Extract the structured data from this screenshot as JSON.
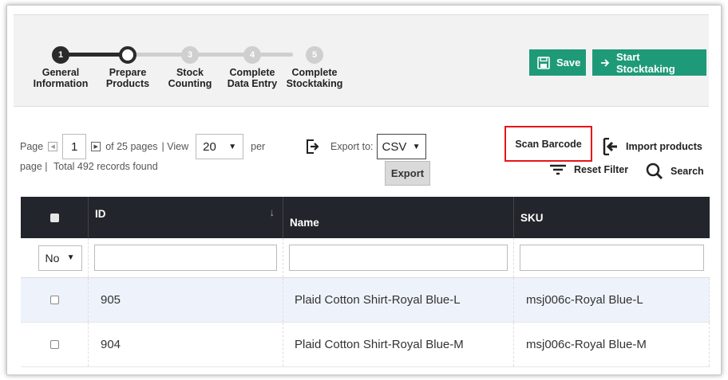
{
  "steps": [
    {
      "num": "1",
      "label": "General\nInformation",
      "state": "done"
    },
    {
      "num": "2",
      "label": "Prepare\nProducts",
      "state": "current"
    },
    {
      "num": "3",
      "label": "Stock\nCounting",
      "state": "todo"
    },
    {
      "num": "4",
      "label": "Complete\nData Entry",
      "state": "todo"
    },
    {
      "num": "5",
      "label": "Complete\nStocktaking",
      "state": "todo"
    }
  ],
  "toolbar": {
    "save_label": "Save",
    "start_label": "Start Stocktaking",
    "accent_color": "#1f9a78"
  },
  "pager": {
    "page_prefix": "Page",
    "page_value": "1",
    "of_pages": "of 25 pages",
    "view_label": "| View",
    "view_value": "20",
    "per_label": "per",
    "page_word": "page |",
    "total_label": "Total 492 records found"
  },
  "export": {
    "label": "Export to:",
    "format": "CSV",
    "button": "Export"
  },
  "actions": {
    "scan_barcode": "Scan Barcode",
    "import_products": "Import products",
    "reset_filter": "Reset Filter",
    "search": "Search"
  },
  "grid": {
    "columns": [
      "ID",
      "Name",
      "SKU"
    ],
    "filter_select": "No",
    "rows": [
      {
        "id": "905",
        "name": "Plaid Cotton Shirt-Royal Blue-L",
        "sku": "msj006c-Royal Blue-L"
      },
      {
        "id": "904",
        "name": "Plaid Cotton Shirt-Royal Blue-M",
        "sku": "msj006c-Royal Blue-M"
      }
    ]
  }
}
